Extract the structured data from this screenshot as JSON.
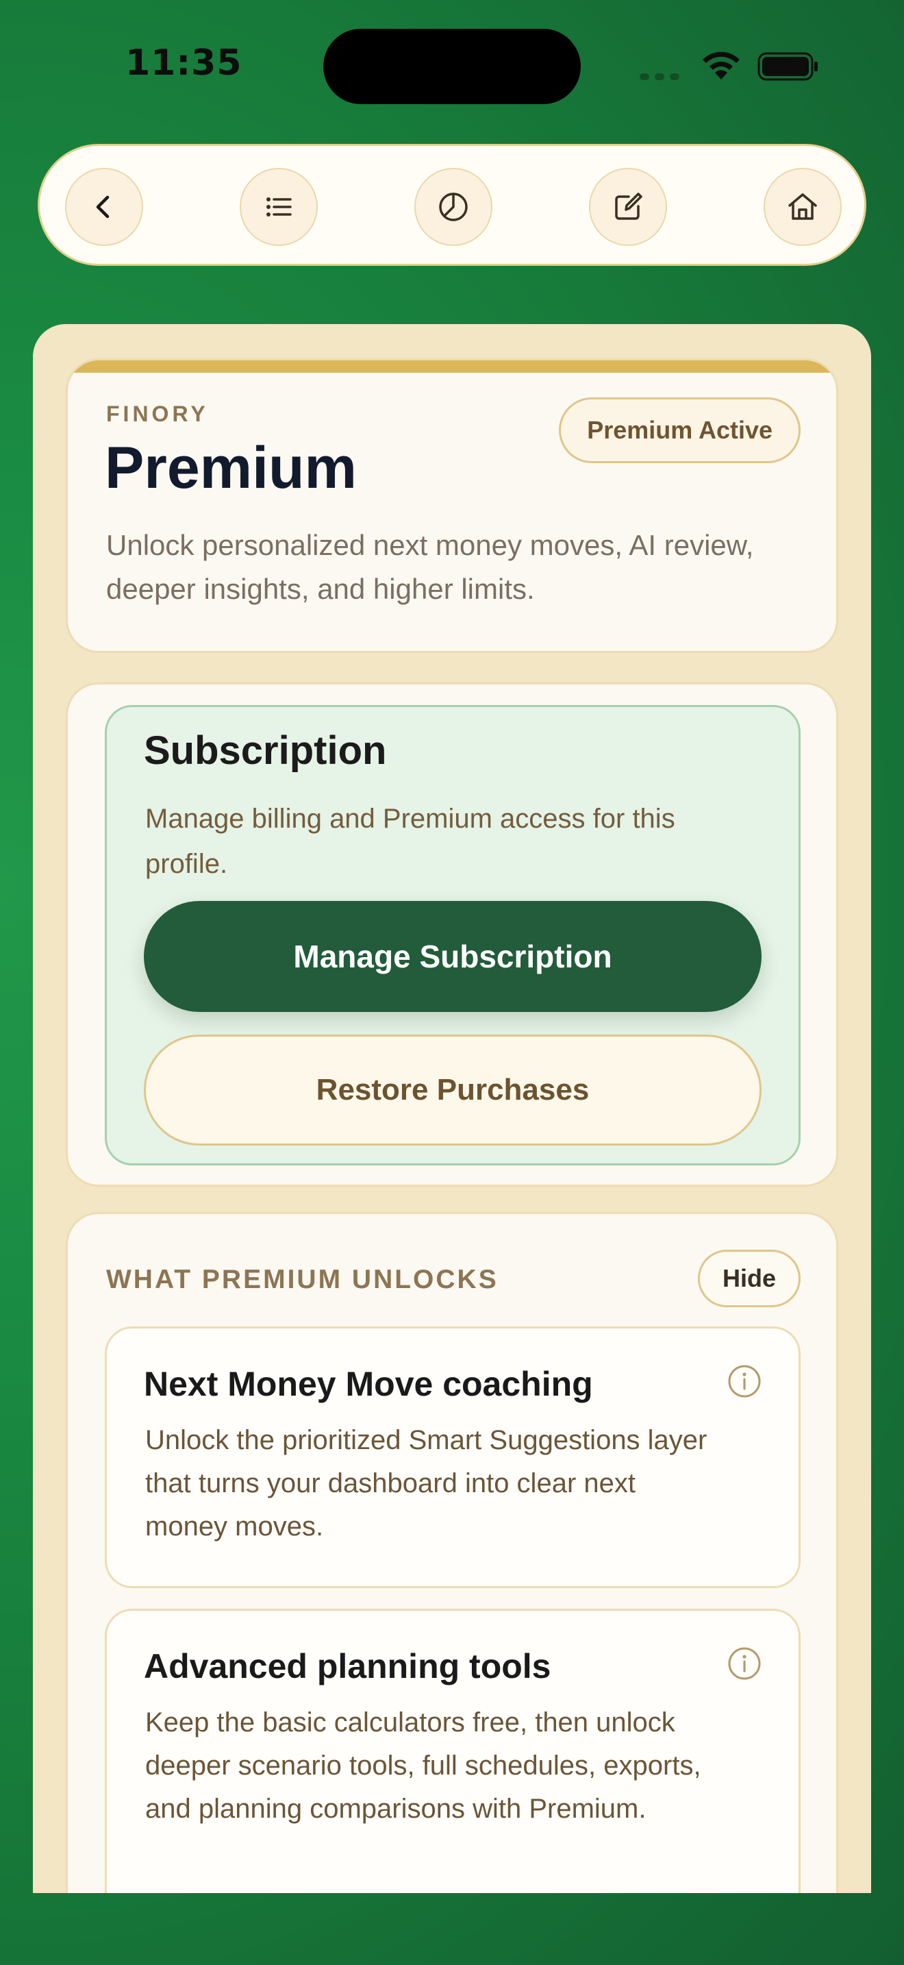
{
  "status_bar": {
    "time": "11:35"
  },
  "nav": {
    "items": [
      {
        "name": "back",
        "icon": "chevron-left-icon"
      },
      {
        "name": "list",
        "icon": "list-icon"
      },
      {
        "name": "chart",
        "icon": "pie-chart-icon"
      },
      {
        "name": "edit",
        "icon": "edit-icon"
      },
      {
        "name": "home",
        "icon": "home-icon"
      }
    ]
  },
  "hero": {
    "brand": "FINORY",
    "title": "Premium",
    "badge": "Premium Active",
    "description": "Unlock personalized next money moves, AI review, deeper insights, and higher limits."
  },
  "subscription": {
    "title": "Subscription",
    "description": "Manage billing and Premium access for this profile.",
    "manage_label": "Manage Subscription",
    "restore_label": "Restore Purchases"
  },
  "unlocks": {
    "heading": "WHAT PREMIUM UNLOCKS",
    "hide_label": "Hide",
    "features": [
      {
        "title": "Next Money Move coaching",
        "description": "Unlock the prioritized Smart Suggestions layer that turns your dashboard into clear next money moves."
      },
      {
        "title": "Advanced planning tools",
        "description": "Keep the basic calculators free, then unlock deeper scenario tools, full schedules, exports, and planning comparisons with Premium."
      }
    ]
  },
  "colors": {
    "background_green": "#1a8a42",
    "primary_button": "#225c3a",
    "accent_gold": "#dcb757",
    "panel_cream": "#f2e6c4"
  }
}
